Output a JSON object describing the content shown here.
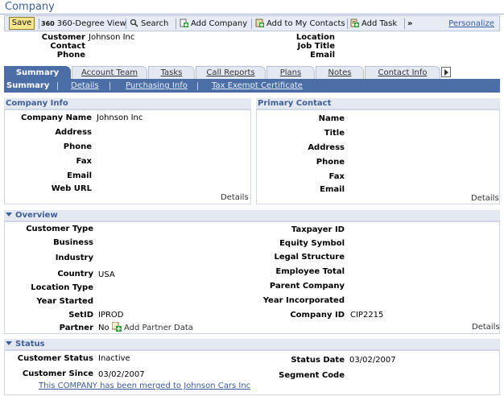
{
  "page": {
    "title": "Company"
  },
  "toolbar": {
    "save": "Save",
    "degree360": "360-Degree View",
    "search": "Search",
    "add_company": "Add Company",
    "add_contacts": "Add to My Contacts",
    "add_task": "Add Task",
    "more": "»",
    "personalize": "Personalize"
  },
  "header": {
    "customer_label": "Customer",
    "customer_value": "Johnson Inc",
    "contact_label": "Contact",
    "contact_value": "",
    "phone_label": "Phone",
    "phone_value": "",
    "location_label": "Location",
    "location_value": "",
    "job_title_label": "Job Title",
    "job_title_value": "",
    "email_label": "Email",
    "email_value": ""
  },
  "tabs": [
    "Summary",
    "Account Team",
    "Tasks",
    "Call Reports",
    "Plans",
    "Notes",
    "Contact Info"
  ],
  "subnav": [
    "Summary",
    "Details",
    "Purchasing Info",
    "Tax Exempt Certificate"
  ],
  "company_info": {
    "title": "Company Info",
    "fields": [
      {
        "label": "Company Name",
        "value": "Johnson Inc"
      },
      {
        "label": "Address",
        "value": ""
      },
      {
        "label": "Phone",
        "value": ""
      },
      {
        "label": "Fax",
        "value": ""
      },
      {
        "label": "Email",
        "value": ""
      },
      {
        "label": "Web URL",
        "value": ""
      }
    ],
    "details": "Details"
  },
  "primary_contact": {
    "title": "Primary Contact",
    "fields": [
      {
        "label": "Name",
        "value": ""
      },
      {
        "label": "Title",
        "value": ""
      },
      {
        "label": "Address",
        "value": ""
      },
      {
        "label": "Phone",
        "value": ""
      },
      {
        "label": "Fax",
        "value": ""
      },
      {
        "label": "Email",
        "value": ""
      }
    ],
    "details": "Details"
  },
  "overview": {
    "title": "Overview",
    "left": [
      {
        "label": "Customer Type",
        "value": ""
      },
      {
        "label": "Business",
        "value": ""
      },
      {
        "label": "Industry",
        "value": ""
      },
      {
        "label": "Country",
        "value": "USA"
      },
      {
        "label": "Location Type",
        "value": ""
      },
      {
        "label": "Year Started",
        "value": ""
      },
      {
        "label": "SetID",
        "value": "IPROD"
      },
      {
        "label": "Partner",
        "value": "No"
      }
    ],
    "add_partner": "Add Partner Data",
    "right": [
      {
        "label": "Taxpayer ID",
        "value": ""
      },
      {
        "label": "Equity Symbol",
        "value": ""
      },
      {
        "label": "Legal Structure",
        "value": ""
      },
      {
        "label": "Employee Total",
        "value": ""
      },
      {
        "label": "Parent Company",
        "value": ""
      },
      {
        "label": "Year Incorporated",
        "value": ""
      },
      {
        "label": "Company ID",
        "value": "CIP2215"
      }
    ],
    "details": "Details"
  },
  "status": {
    "title": "Status",
    "customer_status_label": "Customer Status",
    "customer_status_value": "Inactive",
    "customer_since_label": "Customer Since",
    "customer_since_value": "03/02/2007",
    "status_date_label": "Status Date",
    "status_date_value": "03/02/2007",
    "segment_code_label": "Segment Code",
    "segment_code_value": "",
    "merge_link": "This COMPANY has been merged to Johnson Cars Inc"
  }
}
